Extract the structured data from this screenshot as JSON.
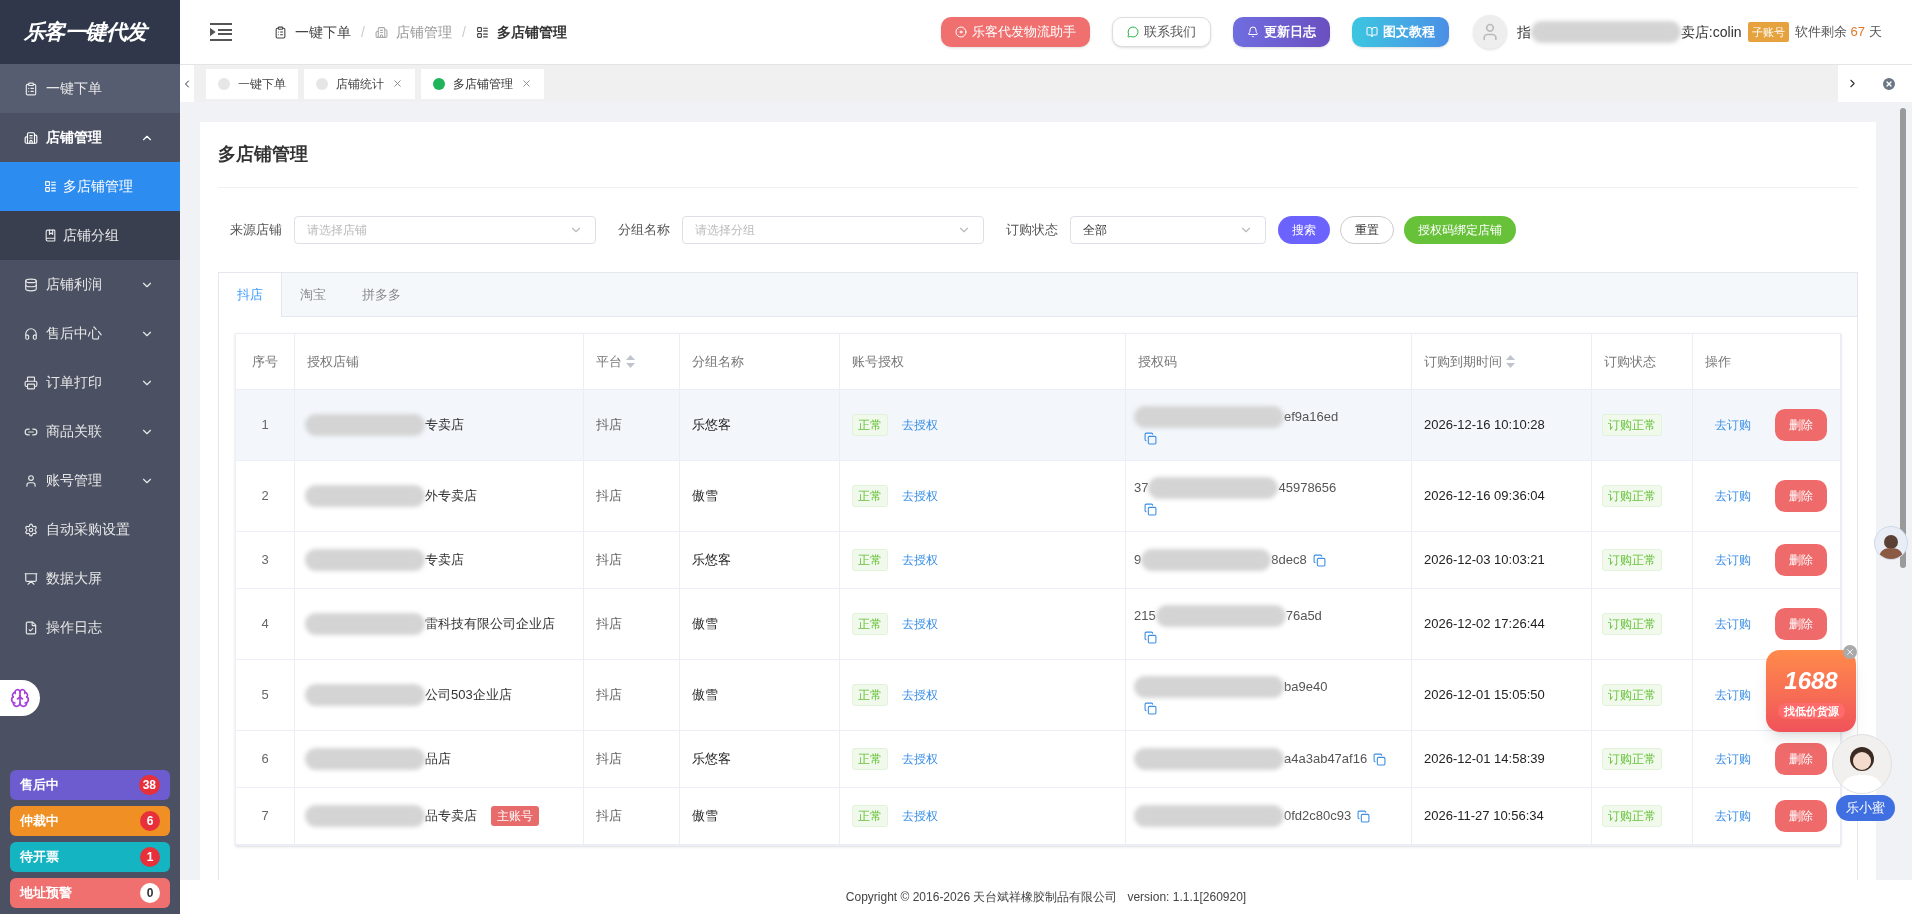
{
  "logo": {
    "text": "乐客一键代发"
  },
  "sidebar": {
    "items": [
      {
        "label": "一键下单",
        "selected": false
      },
      {
        "label": "店铺管理",
        "expanded": true,
        "children": [
          {
            "label": "多店铺管理",
            "selected": true
          },
          {
            "label": "店铺分组",
            "selected": false
          }
        ]
      },
      {
        "label": "店铺利润",
        "expanded": false
      },
      {
        "label": "售后中心",
        "expanded": false
      },
      {
        "label": "订单打印",
        "expanded": false
      },
      {
        "label": "商品关联",
        "expanded": false
      },
      {
        "label": "账号管理",
        "expanded": false
      },
      {
        "label": "自动采购设置",
        "selected": false
      },
      {
        "label": "数据大屏",
        "selected": false
      },
      {
        "label": "操作日志",
        "selected": false
      }
    ],
    "counters": [
      {
        "label": "售后中",
        "count": "38",
        "color": "#6c5ccf",
        "alert": true
      },
      {
        "label": "仲裁中",
        "count": "6",
        "color": "#ef8f24",
        "alert": true
      },
      {
        "label": "待开票",
        "count": "1",
        "color": "#15b4c3",
        "alert": true
      },
      {
        "label": "地址预警",
        "count": "0",
        "color": "#f07070",
        "alert": false
      }
    ]
  },
  "breadcrumb": {
    "separator": "/",
    "items": [
      "一键下单",
      "店铺管理",
      "多店铺管理"
    ]
  },
  "header_buttons": [
    {
      "label": "乐客代发物流助手",
      "kind": "red"
    },
    {
      "label": "联系我们",
      "kind": "outline"
    },
    {
      "label": "更新日志",
      "kind": "purple"
    },
    {
      "label": "图文教程",
      "kind": "cyan"
    }
  ],
  "user": {
    "name_start": "指",
    "name_end": "卖店:colin",
    "role": "子账号",
    "remaining_label": "软件剩余",
    "remaining_days": "67",
    "remaining_unit": "天"
  },
  "page_tabs": [
    {
      "label": "一键下单",
      "selected": false,
      "closable": false
    },
    {
      "label": "店铺统计",
      "selected": false,
      "closable": true
    },
    {
      "label": "多店铺管理",
      "selected": true,
      "closable": true
    }
  ],
  "page": {
    "title": "多店铺管理",
    "filters": [
      {
        "label": "来源店铺",
        "placeholder": "请选择店铺"
      },
      {
        "label": "分组名称",
        "placeholder": "请选择分组"
      },
      {
        "label": "订购状态",
        "value": "全部"
      }
    ],
    "buttons": [
      {
        "label": "搜索",
        "kind": "primary"
      },
      {
        "label": "重置",
        "kind": "default"
      },
      {
        "label": "授权码绑定店铺",
        "kind": "success"
      }
    ],
    "platform_tabs": [
      {
        "label": "抖店",
        "selected": true
      },
      {
        "label": "淘宝",
        "selected": false
      },
      {
        "label": "拼多多",
        "selected": false
      }
    ],
    "table": {
      "columns": [
        {
          "label": "序号",
          "sortable": false
        },
        {
          "label": "授权店铺",
          "sortable": false
        },
        {
          "label": "平台",
          "sortable": true
        },
        {
          "label": "分组名称",
          "sortable": false
        },
        {
          "label": "账号授权",
          "sortable": false
        },
        {
          "label": "授权码",
          "sortable": false
        },
        {
          "label": "订购到期时间",
          "sortable": true
        },
        {
          "label": "订购状态",
          "sortable": false
        },
        {
          "label": "操作",
          "sortable": false
        }
      ],
      "rows": [
        {
          "index": "1",
          "shop": "专卖店",
          "main_badge": null,
          "platform": "抖店",
          "group": "乐悠客",
          "auth": "正常",
          "auth_link": "去授权",
          "code_start": "",
          "code_end": "ef9a16ed",
          "copy_inline": false,
          "expiry": "2026-12-16 10:10:28",
          "status": "订购正常",
          "order_link": "去订购",
          "delete": "删除",
          "highlighted": true
        },
        {
          "index": "2",
          "shop": "外专卖店",
          "main_badge": null,
          "platform": "抖店",
          "group": "傲雪",
          "auth": "正常",
          "auth_link": "去授权",
          "code_start": "37",
          "code_end": "45978656",
          "copy_inline": false,
          "expiry": "2026-12-16 09:36:04",
          "status": "订购正常",
          "order_link": "去订购",
          "delete": "删除",
          "highlighted": false
        },
        {
          "index": "3",
          "shop": "专卖店",
          "main_badge": null,
          "platform": "抖店",
          "group": "乐悠客",
          "auth": "正常",
          "auth_link": "去授权",
          "code_start": "9",
          "code_end": "8dec8",
          "copy_inline": true,
          "expiry": "2026-12-03 10:03:21",
          "status": "订购正常",
          "order_link": "去订购",
          "delete": "删除",
          "highlighted": false
        },
        {
          "index": "4",
          "shop": "雷科技有限公司企业店",
          "main_badge": null,
          "platform": "抖店",
          "group": "傲雪",
          "auth": "正常",
          "auth_link": "去授权",
          "code_start": "215",
          "code_end": "76a5d",
          "copy_inline": false,
          "expiry": "2026-12-02 17:26:44",
          "status": "订购正常",
          "order_link": "去订购",
          "delete": "删除",
          "highlighted": false
        },
        {
          "index": "5",
          "shop": "公司503企业店",
          "main_badge": null,
          "platform": "抖店",
          "group": "傲雪",
          "auth": "正常",
          "auth_link": "去授权",
          "code_start": "",
          "code_end": "ba9e40",
          "copy_inline": false,
          "expiry": "2026-12-01 15:05:50",
          "status": "订购正常",
          "order_link": "去订购",
          "delete": null,
          "highlighted": false
        },
        {
          "index": "6",
          "shop": "品店",
          "main_badge": null,
          "platform": "抖店",
          "group": "乐悠客",
          "auth": "正常",
          "auth_link": "去授权",
          "code_start": "",
          "code_end": "a4a3ab47af16",
          "copy_inline": true,
          "expiry": "2026-12-01 14:58:39",
          "status": "订购正常",
          "order_link": "去订购",
          "delete": "删除",
          "highlighted": false
        },
        {
          "index": "7",
          "shop": "品专卖店",
          "main_badge": "主账号",
          "platform": "抖店",
          "group": "傲雪",
          "auth": "正常",
          "auth_link": "去授权",
          "code_start": "",
          "code_end": "0fd2c80c93",
          "copy_inline": true,
          "expiry": "2026-11-27 10:56:34",
          "status": "订购正常",
          "order_link": "去订购",
          "delete": "删除",
          "highlighted": false
        }
      ]
    }
  },
  "promo": {
    "number": "1688",
    "caption": "找低价货源"
  },
  "assistant": {
    "label": "乐小蜜"
  },
  "footer": {
    "copyright": "Copyright © 2016-2026 天台斌祥橡胶制品有限公司",
    "version": "version: 1.1.1[260920]"
  }
}
